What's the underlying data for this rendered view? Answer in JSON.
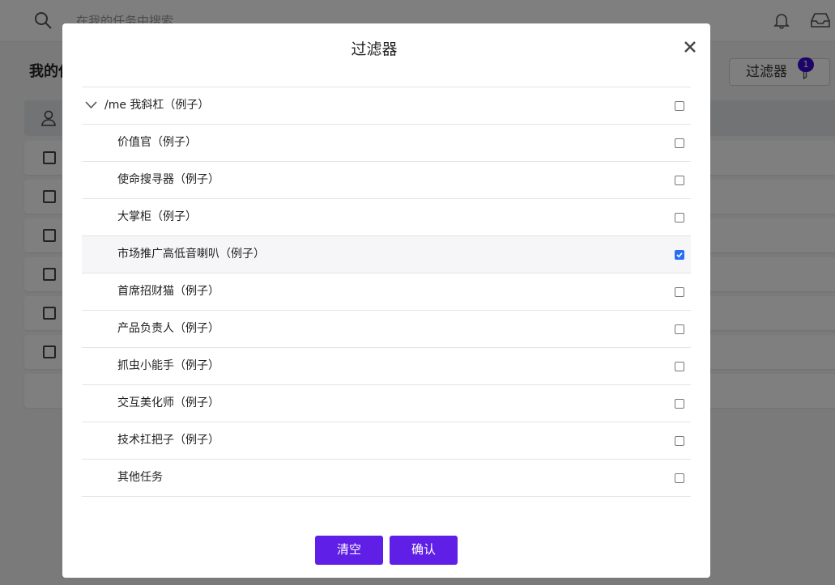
{
  "background": {
    "search_placeholder": "在我的任务中搜索",
    "page_title": "我的任务",
    "filter_button_label": "过滤器",
    "filter_badge_count": "1"
  },
  "modal": {
    "title": "过滤器",
    "items": [
      {
        "label": "/me 我斜杠（例子）",
        "checked": false,
        "parent": true
      },
      {
        "label": "价值官（例子）",
        "checked": false
      },
      {
        "label": "使命搜寻器（例子）",
        "checked": false
      },
      {
        "label": "大掌柜（例子）",
        "checked": false
      },
      {
        "label": "市场推广高低音喇叭（例子）",
        "checked": true
      },
      {
        "label": "首席招财猫（例子）",
        "checked": false
      },
      {
        "label": "产品负责人（例子）",
        "checked": false
      },
      {
        "label": "抓虫小能手（例子）",
        "checked": false
      },
      {
        "label": "交互美化师（例子）",
        "checked": false
      },
      {
        "label": "技术扛把子（例子）",
        "checked": false
      },
      {
        "label": "其他任务",
        "checked": false
      }
    ],
    "clear_label": "清空",
    "confirm_label": "确认"
  },
  "colors": {
    "primary_button": "#5f1fe6",
    "checkbox_checked": "#2a6ef5",
    "badge": "#3b0bd1"
  }
}
